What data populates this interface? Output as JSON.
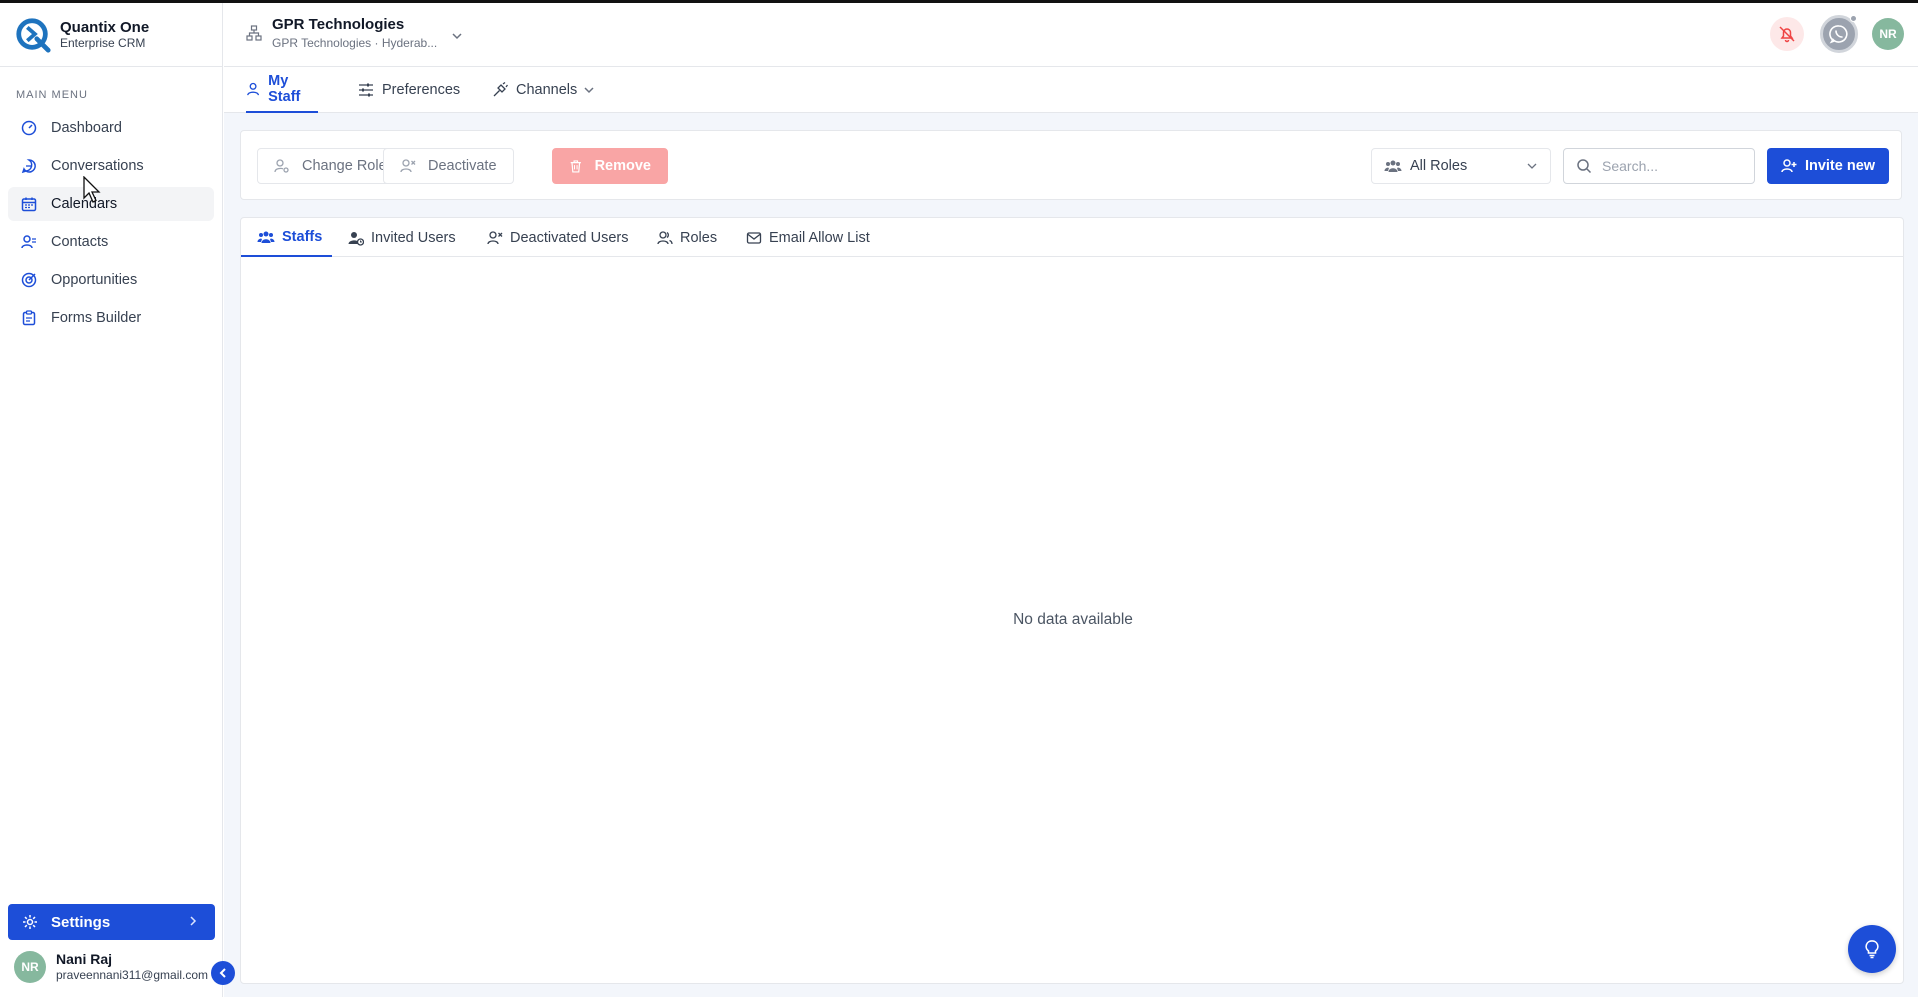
{
  "brand": {
    "name": "Quantix One",
    "subtitle": "Enterprise CRM"
  },
  "sidebar": {
    "menu_title": "MAIN MENU",
    "items": [
      {
        "label": "Dashboard",
        "icon": "gauge-icon"
      },
      {
        "label": "Conversations",
        "icon": "chat-bubble-icon"
      },
      {
        "label": "Calendars",
        "icon": "calendar-icon",
        "hovered": true
      },
      {
        "label": "Contacts",
        "icon": "contacts-icon"
      },
      {
        "label": "Opportunities",
        "icon": "target-icon"
      },
      {
        "label": "Forms Builder",
        "icon": "clipboard-icon"
      }
    ],
    "settings_label": "Settings",
    "user": {
      "initials": "NR",
      "name": "Nani Raj",
      "email": "praveennani311@gmail.com"
    }
  },
  "header": {
    "org_name": "GPR Technologies",
    "org_sub": "GPR Technologies · Hyderab...",
    "avatar_initials": "NR"
  },
  "subnav": {
    "items": [
      {
        "label": "My Staff",
        "active": true
      },
      {
        "label": "Preferences"
      },
      {
        "label": "Channels"
      }
    ]
  },
  "toolbar": {
    "change_role": "Change Role",
    "deactivate": "Deactivate",
    "remove": "Remove",
    "roles_filter": "All Roles",
    "search_placeholder": "Search...",
    "invite": "Invite new"
  },
  "tabs": [
    {
      "label": "Staffs",
      "active": true
    },
    {
      "label": "Invited Users"
    },
    {
      "label": "Deactivated Users"
    },
    {
      "label": "Roles"
    },
    {
      "label": "Email Allow List"
    }
  ],
  "empty_message": "No data available",
  "colors": {
    "primary": "#1d4ed8",
    "danger_soft": "#f9a5a5",
    "content_bg": "#f3f6fb"
  }
}
